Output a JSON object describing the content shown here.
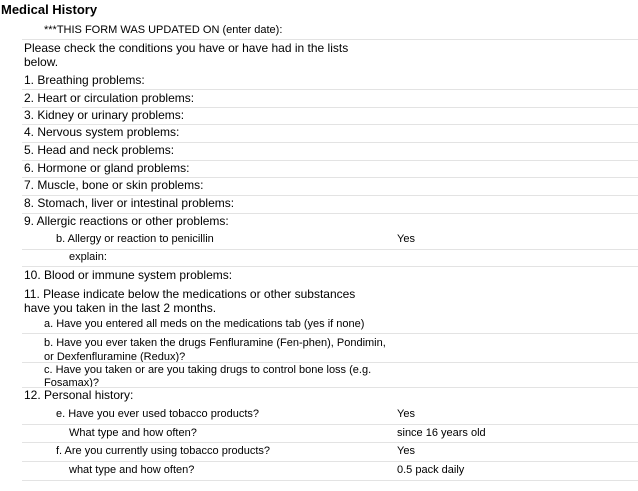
{
  "title": "Medical History",
  "updated_note": "***THIS FORM WAS UPDATED ON (enter date):",
  "instructions": "Please check the conditions you have or have had in the lists below.",
  "conditions": [
    "1. Breathing problems:",
    "2. Heart or circulation problems:",
    "3. Kidney or urinary problems:",
    "4. Nervous system problems:",
    "5. Head and neck problems:",
    "6. Hormone or gland problems:",
    "7. Muscle, bone or skin problems:",
    "8. Stomach, liver or intestinal problems:",
    "9. Allergic reactions or other problems:"
  ],
  "allergy": {
    "question": "b. Allergy or reaction to penicillin",
    "answer": "Yes",
    "explain_label": "explain:"
  },
  "blood": "10. Blood or immune system problems:",
  "medications": {
    "question": "11.  Please indicate below the medications or other substances have you taken in the last  2 months.",
    "a": "a. Have you entered all meds on the medications tab (yes if none)",
    "b": "b. Have you ever taken the drugs Fenfluramine (Fen-phen), Pondimin, or Dexfenfluramine (Redux)?",
    "c": "c. Have you taken or are you taking drugs to control bone loss (e.g. Fosamax)?"
  },
  "personal": {
    "heading": "12. Personal history:",
    "items": [
      {
        "label": "e. Have you ever used tobacco products?",
        "answer": "Yes"
      },
      {
        "label": "What type and how often?",
        "answer": "since 16 years old"
      },
      {
        "label": "f. Are you currently using tobacco products?",
        "answer": "Yes"
      },
      {
        "label": "what type and how often?",
        "answer": "0.5 pack daily"
      }
    ]
  }
}
